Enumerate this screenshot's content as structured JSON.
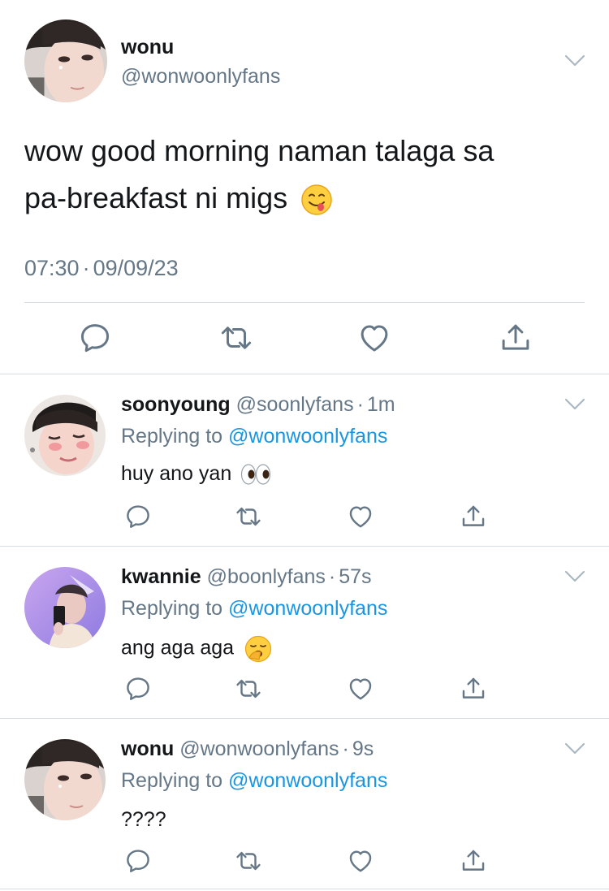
{
  "main_tweet": {
    "display_name": "wonu",
    "handle": "@wonwoonlyfans",
    "text_line1": "wow good morning naman talaga sa",
    "text_line2": "pa-breakfast ni migs",
    "emoji": "face-savoring-food",
    "time": "07:30",
    "separator": "·",
    "date": "09/09/23"
  },
  "replies": [
    {
      "display_name": "soonyoung",
      "handle": "@soonlyfans",
      "separator": "·",
      "time_ago": "1m",
      "replying_prefix": "Replying to",
      "replying_handle": "@wonwoonlyfans",
      "text": "huy ano yan",
      "emoji": "eyes"
    },
    {
      "display_name": "kwannie",
      "handle": "@boonlyfans",
      "separator": "·",
      "time_ago": "57s",
      "replying_prefix": "Replying to",
      "replying_handle": "@wonwoonlyfans",
      "text": "ang aga aga",
      "emoji": "yawning-face"
    },
    {
      "display_name": "wonu",
      "handle": "@wonwoonlyfans",
      "separator": "·",
      "time_ago": "9s",
      "replying_prefix": "Replying to",
      "replying_handle": "@wonwoonlyfans",
      "text": "????",
      "emoji": ""
    }
  ],
  "icons": [
    "reply-icon",
    "retweet-icon",
    "like-icon",
    "share-icon",
    "chevron-down-icon"
  ],
  "colors": {
    "text": "#14171a",
    "muted": "#657786",
    "link": "#1b95e0",
    "divider": "#d8dde2"
  }
}
